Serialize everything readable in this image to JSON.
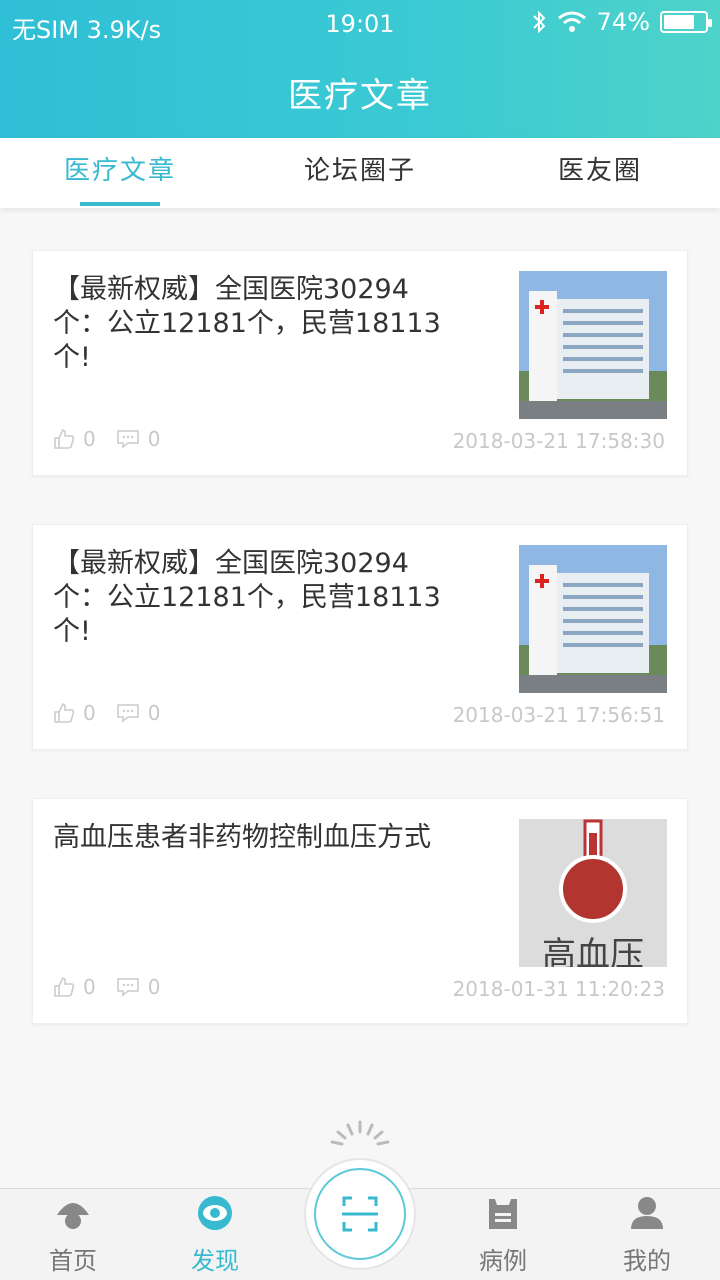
{
  "status_bar": {
    "carrier": "无SIM 3.9K/s",
    "time": "19:01",
    "battery": "74%",
    "battery_level": 0.74
  },
  "header": {
    "title": "医疗文章"
  },
  "tabs": [
    {
      "label": "医疗文章",
      "active": true
    },
    {
      "label": "论坛圈子",
      "active": false
    },
    {
      "label": "医友圈",
      "active": false
    }
  ],
  "articles": [
    {
      "title": "【最新权威】全国医院30294个：公立12181个，民营18113个!",
      "likes": "0",
      "comments": "0",
      "date": "2018-03-21 17:58:30",
      "image": "hospital-building"
    },
    {
      "title": "【最新权威】全国医院30294个：公立12181个，民营18113个!",
      "likes": "0",
      "comments": "0",
      "date": "2018-03-21 17:56:51",
      "image": "hospital-building"
    },
    {
      "title": "高血压患者非药物控制血压方式",
      "likes": "0",
      "comments": "0",
      "date": "2018-01-31 11:20:23",
      "image": "thermometer",
      "image_text": "高血压"
    }
  ],
  "bottom_nav": [
    {
      "label": "首页",
      "icon": "home-icon"
    },
    {
      "label": "发现",
      "icon": "eye-icon",
      "active": true
    },
    {
      "label": "",
      "icon": "scan-icon"
    },
    {
      "label": "病例",
      "icon": "case-icon"
    },
    {
      "label": "我的",
      "icon": "user-icon"
    }
  ],
  "colors": {
    "accent": "#37b9cf",
    "header_start": "#2fbfd6",
    "header_end": "#4ed3c9"
  }
}
